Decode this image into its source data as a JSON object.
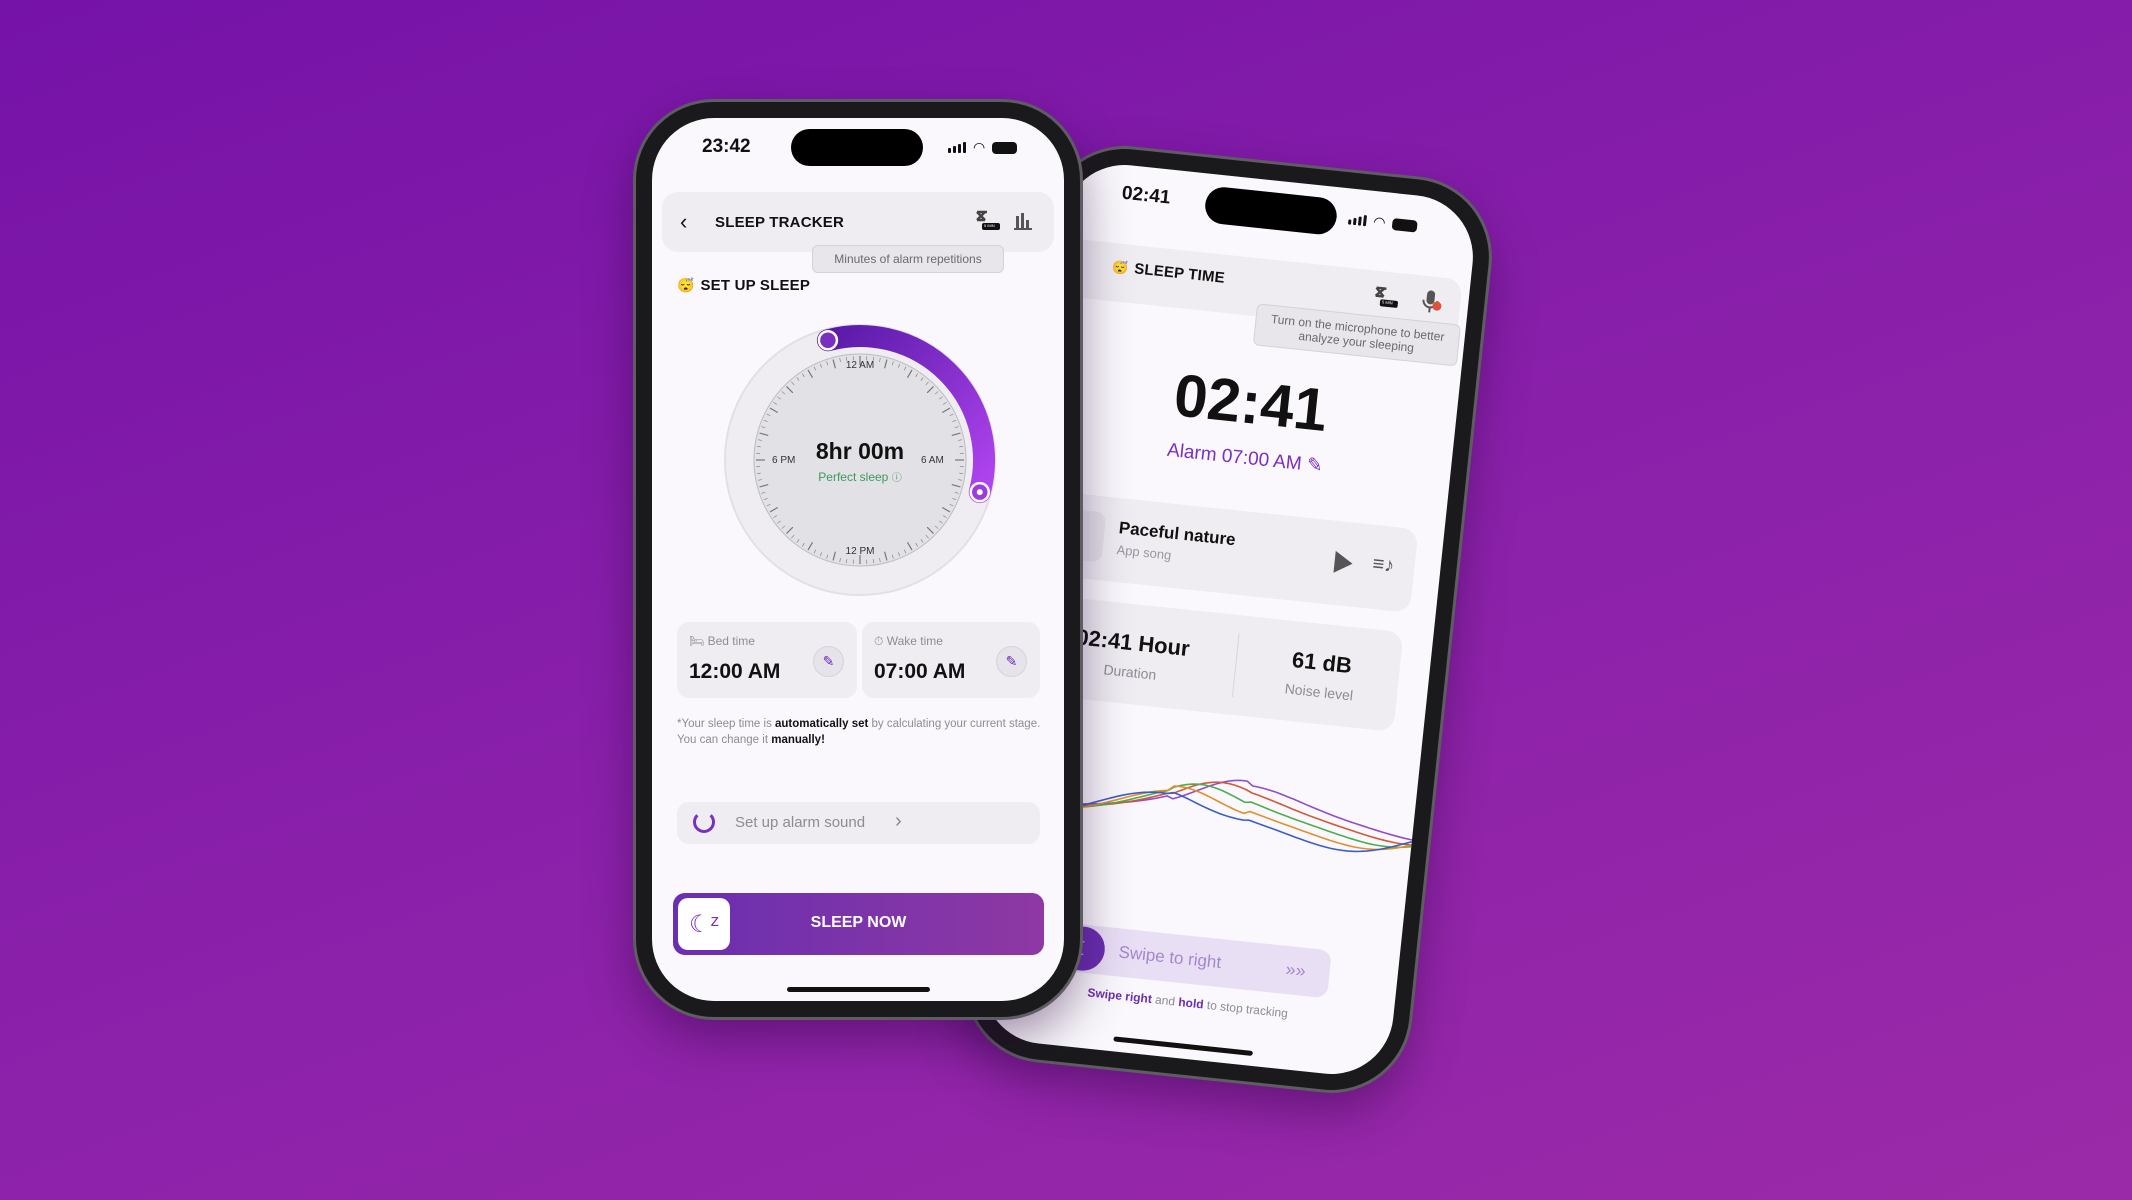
{
  "colors": {
    "background": "#8a20aa",
    "accent": "#7b2fc0",
    "perfect": "#3a9a5a"
  },
  "back_phone": {
    "status_time": "02:41",
    "header": {
      "emoji": "😴",
      "title": "SLEEP TIME",
      "snooze_badge": "5 MIN"
    },
    "tooltip": "Turn on the microphone to better analyze your sleeping",
    "clock": "02:41",
    "alarm": "Alarm 07:00 AM",
    "music": {
      "title": "Paceful nature",
      "subtitle": "App song"
    },
    "stats": {
      "duration_value": "02:41 Hour",
      "duration_label": "Duration",
      "noise_value": "61 dB",
      "noise_label": "Noise level"
    },
    "waves": [
      "#8e4fc8",
      "#d05a3a",
      "#4cae4c",
      "#e0902a",
      "#3a5ec8"
    ],
    "swipe": {
      "label": "Swipe to right",
      "chevrons": "»»",
      "hint_a": "Swipe right",
      "hint_b": " and ",
      "hint_c": "hold",
      "hint_d": " to stop tracking"
    }
  },
  "front_phone": {
    "status_time": "23:42",
    "header": {
      "title": "SLEEP TRACKER",
      "snooze_badge": "5 MIN"
    },
    "tooltip": "Minutes of alarm repetitions",
    "section": {
      "emoji": "😴",
      "title": "SET UP SLEEP"
    },
    "dial": {
      "duration": "8hr 00m",
      "quality": "Perfect sleep",
      "labels": {
        "top": "12 AM",
        "right": "6 AM",
        "bottom": "12 PM",
        "left": "6 PM"
      }
    },
    "bed": {
      "label": "Bed time",
      "value": "12:00 AM"
    },
    "wake": {
      "label": "Wake time",
      "value": "07:00 AM"
    },
    "note": {
      "a": "*Your sleep time is ",
      "b": "automatically set",
      "c": " by calculating your current stage. You can change it ",
      "d": "manually!"
    },
    "alarm_sound": "Set up alarm sound",
    "sleep_now": "SLEEP NOW"
  }
}
